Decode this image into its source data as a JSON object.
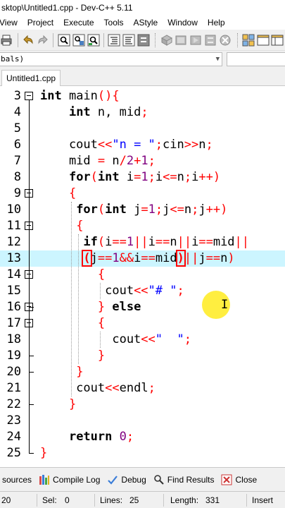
{
  "window": {
    "title": "sktop\\Untitled1.cpp - Dev-C++ 5.11"
  },
  "menu": [
    "View",
    "Project",
    "Execute",
    "Tools",
    "AStyle",
    "Window",
    "Help"
  ],
  "class_combo": {
    "value": "bals)"
  },
  "tab": {
    "label": "Untitled1.cpp"
  },
  "editor": {
    "lines": [
      {
        "num": "3",
        "fold": "open",
        "tokens": [
          [
            "ty",
            "int"
          ],
          [
            "t",
            " main"
          ],
          [
            "par",
            "(){"
          ]
        ]
      },
      {
        "num": "4",
        "tokens": [
          [
            "t",
            "    "
          ],
          [
            "ty",
            "int"
          ],
          [
            "t",
            " n, mid"
          ],
          [
            "op",
            ";"
          ]
        ]
      },
      {
        "num": "5",
        "tokens": []
      },
      {
        "num": "6",
        "tokens": [
          [
            "t",
            "    cout"
          ],
          [
            "op",
            "<<"
          ],
          [
            "str",
            "\"n = \""
          ],
          [
            "op",
            ";"
          ],
          [
            "t",
            "cin"
          ],
          [
            "op",
            ">>"
          ],
          [
            "t",
            "n"
          ],
          [
            "op",
            ";"
          ]
        ]
      },
      {
        "num": "7",
        "tokens": [
          [
            "t",
            "    mid "
          ],
          [
            "op",
            "="
          ],
          [
            "t",
            " n"
          ],
          [
            "op",
            "/"
          ],
          [
            "num",
            "2"
          ],
          [
            "op",
            "+"
          ],
          [
            "num",
            "1"
          ],
          [
            "op",
            ";"
          ]
        ]
      },
      {
        "num": "8",
        "tokens": [
          [
            "t",
            "    "
          ],
          [
            "kw",
            "for"
          ],
          [
            "par",
            "("
          ],
          [
            "ty",
            "int"
          ],
          [
            "t",
            " i"
          ],
          [
            "op",
            "="
          ],
          [
            "num",
            "1"
          ],
          [
            "op",
            ";"
          ],
          [
            "t",
            "i"
          ],
          [
            "op",
            "<="
          ],
          [
            "t",
            "n"
          ],
          [
            "op",
            ";"
          ],
          [
            "t",
            "i"
          ],
          [
            "op",
            "++)"
          ]
        ]
      },
      {
        "num": "9",
        "fold": "open",
        "tokens": [
          [
            "t",
            "    "
          ],
          [
            "par",
            "{"
          ]
        ]
      },
      {
        "num": "10",
        "tokens": [
          [
            "t",
            "     "
          ],
          [
            "kw",
            "for"
          ],
          [
            "par",
            "("
          ],
          [
            "ty",
            "int"
          ],
          [
            "t",
            " j"
          ],
          [
            "op",
            "="
          ],
          [
            "num",
            "1"
          ],
          [
            "op",
            ";"
          ],
          [
            "t",
            "j"
          ],
          [
            "op",
            "<="
          ],
          [
            "t",
            "n"
          ],
          [
            "op",
            ";"
          ],
          [
            "t",
            "j"
          ],
          [
            "op",
            "++)"
          ]
        ]
      },
      {
        "num": "11",
        "fold": "open",
        "tokens": [
          [
            "t",
            "     "
          ],
          [
            "par",
            "{"
          ]
        ]
      },
      {
        "num": "12",
        "tokens": [
          [
            "t",
            "      "
          ],
          [
            "kw",
            "if"
          ],
          [
            "par",
            "("
          ],
          [
            "t",
            "i"
          ],
          [
            "op",
            "=="
          ],
          [
            "num",
            "1"
          ],
          [
            "op",
            "||"
          ],
          [
            "t",
            "i"
          ],
          [
            "op",
            "=="
          ],
          [
            "t",
            "n"
          ],
          [
            "op",
            "||"
          ],
          [
            "t",
            "i"
          ],
          [
            "op",
            "=="
          ],
          [
            "t",
            "mid"
          ],
          [
            "op",
            "||"
          ]
        ]
      },
      {
        "num": "13",
        "active": true,
        "tokens": [
          [
            "t",
            "      "
          ],
          [
            "brhl",
            "("
          ],
          [
            "t",
            "j"
          ],
          [
            "op",
            "=="
          ],
          [
            "num",
            "1"
          ],
          [
            "op",
            "&&"
          ],
          [
            "t",
            "i"
          ],
          [
            "op",
            "=="
          ],
          [
            "t",
            "mid"
          ],
          [
            "brhl",
            ")"
          ],
          [
            "op",
            "||"
          ],
          [
            "t",
            "j"
          ],
          [
            "op",
            "=="
          ],
          [
            "t",
            "n"
          ],
          [
            "par",
            ")"
          ]
        ]
      },
      {
        "num": "14",
        "fold": "open",
        "tokens": [
          [
            "t",
            "        "
          ],
          [
            "par",
            "{"
          ]
        ]
      },
      {
        "num": "15",
        "tokens": [
          [
            "t",
            "         cout"
          ],
          [
            "op",
            "<<"
          ],
          [
            "str",
            "\"# \""
          ],
          [
            "op",
            ";"
          ]
        ]
      },
      {
        "num": "16",
        "fold": "open",
        "tokens": [
          [
            "t",
            "        "
          ],
          [
            "par",
            "}"
          ],
          [
            "t",
            " "
          ],
          [
            "kw",
            "else"
          ]
        ]
      },
      {
        "num": "17",
        "fold": "open",
        "tokens": [
          [
            "t",
            "        "
          ],
          [
            "par",
            "{"
          ]
        ]
      },
      {
        "num": "18",
        "tokens": [
          [
            "t",
            "          cout"
          ],
          [
            "op",
            "<<"
          ],
          [
            "str",
            "\"  \""
          ],
          [
            "op",
            ";"
          ]
        ]
      },
      {
        "num": "19",
        "tokens": [
          [
            "t",
            "        "
          ],
          [
            "par",
            "}"
          ]
        ]
      },
      {
        "num": "20",
        "tokens": [
          [
            "t",
            "     "
          ],
          [
            "par",
            "}"
          ]
        ]
      },
      {
        "num": "21",
        "tokens": [
          [
            "t",
            "     cout"
          ],
          [
            "op",
            "<<"
          ],
          [
            "t",
            "endl"
          ],
          [
            "op",
            ";"
          ]
        ]
      },
      {
        "num": "22",
        "tokens": [
          [
            "t",
            "    "
          ],
          [
            "par",
            "}"
          ]
        ]
      },
      {
        "num": "23",
        "tokens": []
      },
      {
        "num": "24",
        "tokens": [
          [
            "t",
            "    "
          ],
          [
            "kw",
            "return"
          ],
          [
            "t",
            " "
          ],
          [
            "num",
            "0"
          ],
          [
            "op",
            ";"
          ]
        ]
      },
      {
        "num": "25",
        "tokens": [
          [
            "par",
            "}"
          ]
        ]
      }
    ]
  },
  "bottom_tabs": [
    {
      "label": "sources",
      "icon": ""
    },
    {
      "label": "Compile Log",
      "icon": "compile-log-icon"
    },
    {
      "label": "Debug",
      "icon": "debug-check-icon"
    },
    {
      "label": "Find Results",
      "icon": "find-results-icon"
    },
    {
      "label": "Close",
      "icon": "close-icon"
    }
  ],
  "status": {
    "line": "20",
    "sel_label": "Sel:",
    "sel": "0",
    "lines_label": "Lines:",
    "lines": "25",
    "length_label": "Length:",
    "length": "331",
    "mode": "Insert"
  },
  "colors": {
    "active_line": "#ccf5ff",
    "operator": "#ff0000",
    "string": "#0000ff",
    "number": "#800080",
    "cursor_highlight": "#ffe800"
  }
}
